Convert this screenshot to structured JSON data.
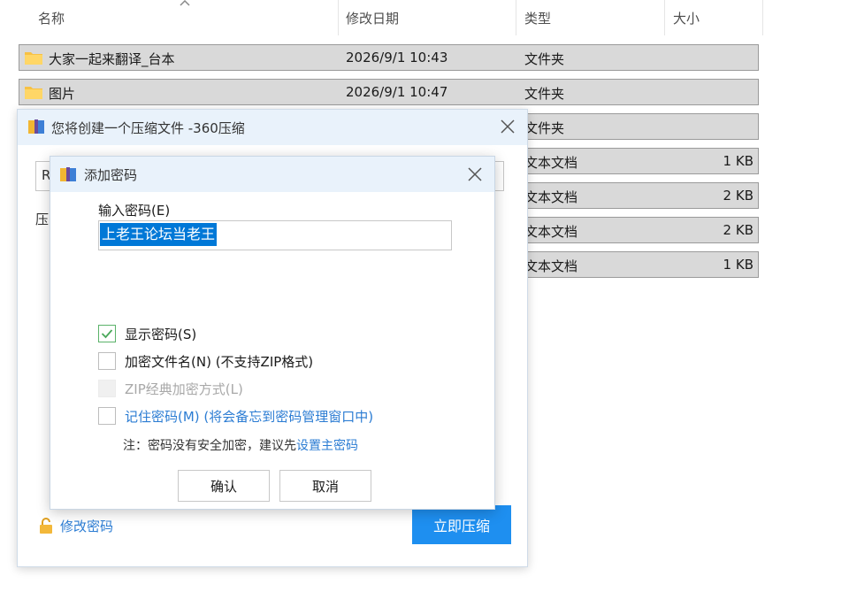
{
  "explorer": {
    "columns": {
      "name": "名称",
      "date": "修改日期",
      "type": "类型",
      "size": "大小"
    },
    "rows": [
      {
        "name": "大家一起来翻译_台本",
        "date": "2026/9/1 10:43",
        "type": "文件夹",
        "size": "",
        "icon": "folder-icon"
      },
      {
        "name": "图片",
        "date": "2026/9/1 10:47",
        "type": "文件夹",
        "size": "",
        "icon": "folder-icon"
      },
      {
        "name": "",
        "date": "",
        "type": "文件夹",
        "size": ""
      },
      {
        "name": "",
        "date": "",
        "type": "文本文档",
        "size": "1 KB"
      },
      {
        "name": "",
        "date": "",
        "type": "文本文档",
        "size": "2 KB"
      },
      {
        "name": "",
        "date": "",
        "type": "文本文档",
        "size": "2 KB"
      },
      {
        "name": "",
        "date": "",
        "type": "文本文档",
        "size": "1 KB"
      }
    ]
  },
  "compress_window": {
    "title": "您将创建一个压缩文件 -360压缩",
    "partial_input_char": "R",
    "partial_label_char": "压",
    "change_password": "修改密码",
    "compress_button": "立即压缩"
  },
  "password_dialog": {
    "title": "添加密码",
    "password_label": "输入密码(E)",
    "password_value": "上老王论坛当老王",
    "options": {
      "show_password": {
        "label": "显示密码(S)",
        "checked": true
      },
      "encrypt_filenames": {
        "label": "加密文件名(N) (不支持ZIP格式)",
        "checked": false
      },
      "zip_classic": {
        "label": "ZIP经典加密方式(L)",
        "checked": false,
        "disabled": true
      },
      "remember_password": {
        "label": "记住密码(M) (将会备忘到密码管理窗口中)",
        "checked": false
      }
    },
    "note_text": "注：密码没有安全加密，建议先",
    "note_link": "设置主密码",
    "ok_button": "确认",
    "cancel_button": "取消"
  },
  "colors": {
    "accent": "#1e8ff0",
    "link": "#2b7cd3",
    "selection": "#0078d7",
    "titlebar": "#e9f2fb",
    "row_highlight": "#d9d9d9",
    "check": "#5bb26a"
  }
}
